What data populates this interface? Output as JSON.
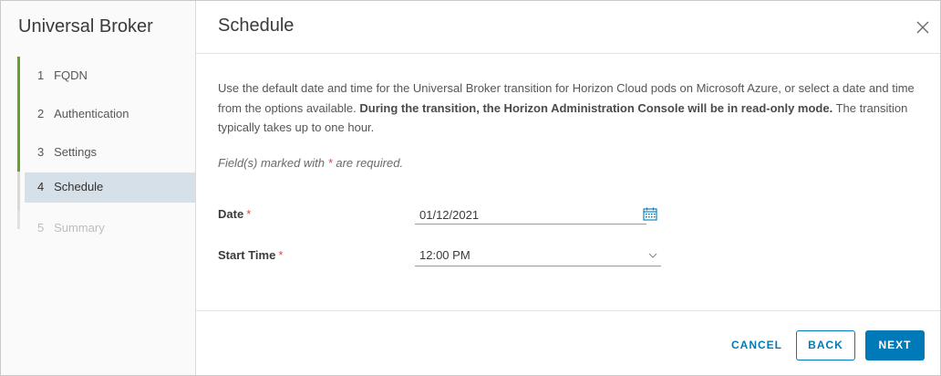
{
  "wizard": {
    "title": "Universal Broker",
    "steps": [
      {
        "number": "1",
        "label": "FQDN",
        "state": "completed"
      },
      {
        "number": "2",
        "label": "Authentication",
        "state": "completed"
      },
      {
        "number": "3",
        "label": "Settings",
        "state": "completed"
      },
      {
        "number": "4",
        "label": "Schedule",
        "state": "current"
      },
      {
        "number": "5",
        "label": "Summary",
        "state": "pending"
      }
    ]
  },
  "page": {
    "title": "Schedule",
    "description_plain": "Use the default date and time for the Universal Broker transition for Horizon Cloud pods on Microsoft Azure, or select a date and time from the options available.",
    "description_bold": "During the transition, the Horizon Administration Console will be in read-only mode.",
    "description_tail": "The transition typically takes up to one hour.",
    "required_note_prefix": "Field(s) marked with",
    "required_note_asterisk": "*",
    "required_note_suffix": "are required."
  },
  "form": {
    "date": {
      "label": "Date",
      "required_mark": "*",
      "value": "01/12/2021"
    },
    "start_time": {
      "label": "Start Time",
      "required_mark": "*",
      "value": "12:00 PM"
    }
  },
  "footer": {
    "cancel_label": "CANCEL",
    "back_label": "BACK",
    "next_label": "NEXT"
  },
  "icons": {
    "close": "close-icon",
    "calendar": "calendar-icon",
    "dropdown": "chevron-down-icon"
  },
  "colors": {
    "accent": "#0079b8",
    "completed_step": "#62a420",
    "current_step_bg": "#d6e0e8",
    "required": "#d94b4b"
  }
}
